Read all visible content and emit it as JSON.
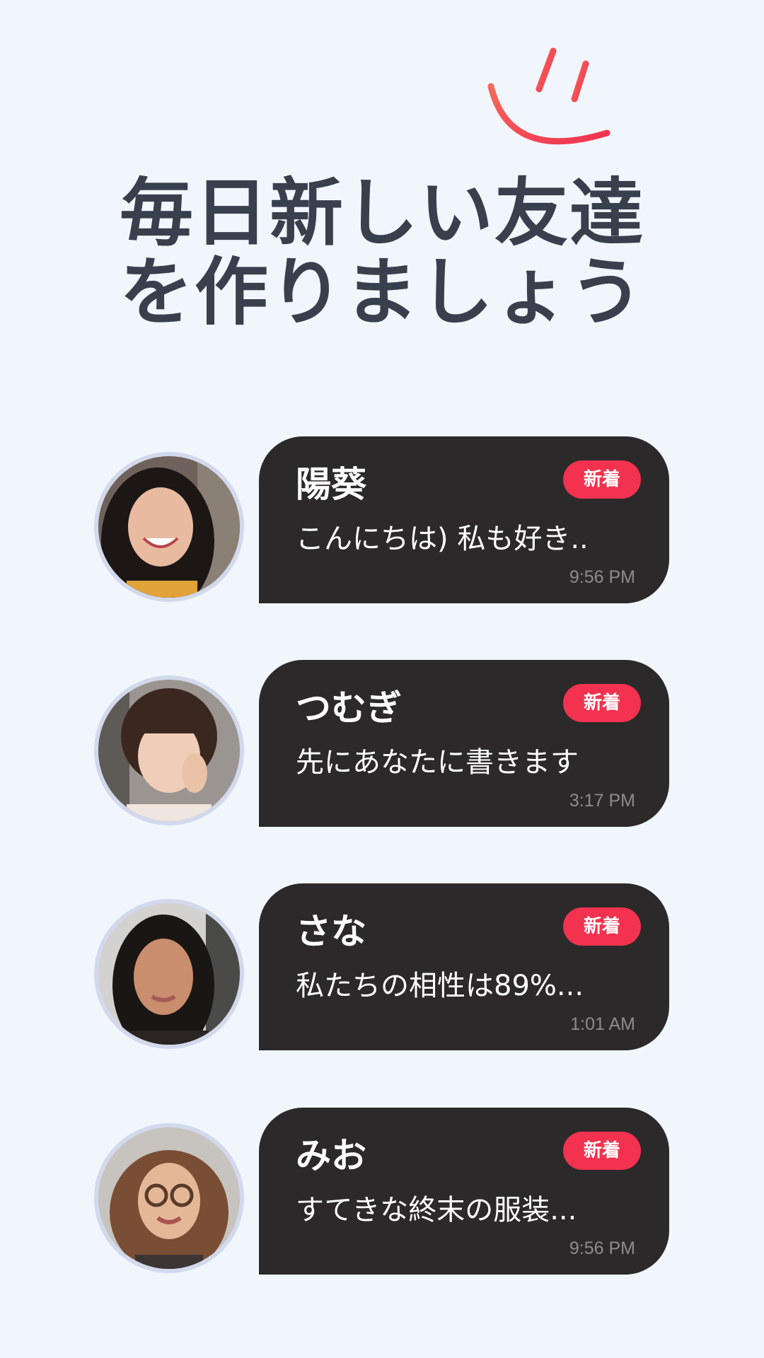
{
  "headline": {
    "line1": "毎日新しい友達",
    "line2": "を作りましょう"
  },
  "decoration": {
    "icon": "smile-icon",
    "color": "#f2324f"
  },
  "colors": {
    "background": "#f1f6fd",
    "bubble": "#2b2929",
    "badge": "#f2324f",
    "headline": "#3a3f4d"
  },
  "chats": [
    {
      "name": "陽葵",
      "badge": "新着",
      "message": "こんにちは) 私も好き..",
      "time": "9:56 PM"
    },
    {
      "name": "つむぎ",
      "badge": "新着",
      "message": "先にあなたに書きます",
      "time": "3:17 PM"
    },
    {
      "name": "さな",
      "badge": "新着",
      "message": "私たちの相性は89%...",
      "time": "1:01 AM"
    },
    {
      "name": "みお",
      "badge": "新着",
      "message": "すてきな終末の服装...",
      "time": "9:56 PM"
    }
  ]
}
